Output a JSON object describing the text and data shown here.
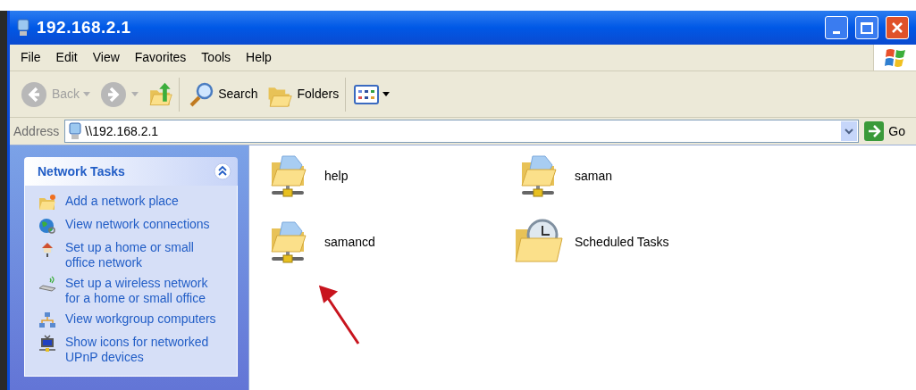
{
  "window": {
    "title": "192.168.2.1"
  },
  "menu": [
    "File",
    "Edit",
    "View",
    "Favorites",
    "Tools",
    "Help"
  ],
  "toolbar": [
    {
      "kind": "back",
      "label": "Back",
      "disabled": true
    },
    {
      "kind": "forward",
      "disabled": true
    },
    {
      "kind": "up"
    },
    {
      "kind": "search",
      "label": "Search"
    },
    {
      "kind": "folders",
      "label": "Folders"
    },
    {
      "kind": "views"
    }
  ],
  "address": {
    "label": "Address",
    "value": "\\\\192.168.2.1",
    "go": "Go"
  },
  "tasks": {
    "title": "Network Tasks",
    "expanded": true,
    "items": [
      {
        "kind": "add",
        "label": "Add a network place"
      },
      {
        "kind": "connections",
        "label": "View network connections"
      },
      {
        "kind": "home",
        "label": "Set up a home or small office network"
      },
      {
        "kind": "wireless",
        "label": "Set up a wireless network for a home or small office"
      },
      {
        "kind": "workgroup",
        "label": "View workgroup computers"
      },
      {
        "kind": "upnp",
        "label": "Show icons for networked UPnP devices"
      }
    ]
  },
  "items": [
    {
      "kind": "share",
      "label": "help"
    },
    {
      "kind": "share",
      "label": "saman"
    },
    {
      "kind": "share",
      "label": "samancd"
    },
    {
      "kind": "scheduled",
      "label": "Scheduled Tasks"
    }
  ]
}
